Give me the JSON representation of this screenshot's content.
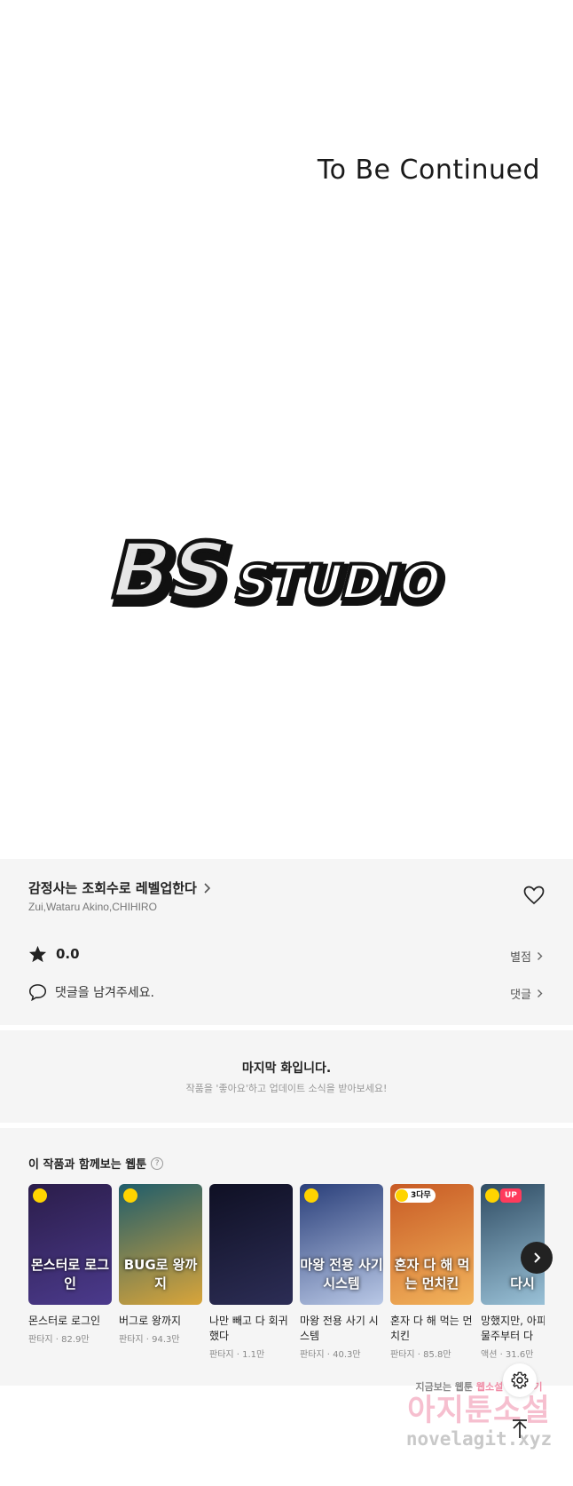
{
  "comic": {
    "to_be_continued": "To Be Continued",
    "logo_text_bs": "BS",
    "logo_text_studio": "STUDIO"
  },
  "info": {
    "title": "감정사는 조회수로 레벨업한다",
    "authors": "Zui,Wataru Akino,CHIHIRO",
    "rating": "0.0",
    "rate_link": "별점",
    "comment_prompt": "댓글을 남겨주세요.",
    "comment_link": "댓글"
  },
  "last_episode": {
    "title": "마지막 화입니다.",
    "subtitle": "작품을 '좋아요'하고 업데이트 소식을 받아보세요!"
  },
  "recommend": {
    "heading": "이 작품과 함께보는 웹툰",
    "help": "?",
    "items": [
      {
        "name": "몬스터로 로그인",
        "meta": "판타지 · 82.9만",
        "thumb_text": "몬스터로 로그인",
        "badge": "clock",
        "colors": [
          "#2b1d4a",
          "#4b3a8c"
        ]
      },
      {
        "name": "버그로 왕까지",
        "meta": "판타지 · 94.3만",
        "thumb_text": "BUG로 왕까지",
        "badge": "clock",
        "colors": [
          "#1f5d6b",
          "#d9a53a"
        ]
      },
      {
        "name": "나만 빼고 다 회귀했다",
        "meta": "판타지 · 1.1만",
        "thumb_text": "",
        "badge": "",
        "colors": [
          "#0f1024",
          "#2c2d55"
        ]
      },
      {
        "name": "마왕 전용 사기 시스템",
        "meta": "판타지 · 40.3만",
        "thumb_text": "마왕 전용 사기 시스템",
        "badge": "clock",
        "colors": [
          "#2a3f7a",
          "#b9c8e6"
        ]
      },
      {
        "name": "혼자 다 해 먹는 먼치킨",
        "meta": "판타지 · 85.8만",
        "thumb_text": "혼자 다 해 먹는 먼치킨",
        "badge": "3다무",
        "colors": [
          "#c85a24",
          "#f2b45c"
        ]
      },
      {
        "name": "망했지만, 아피 건물주부터 다",
        "meta": "액션 · 31.6만",
        "thumb_text": "다시",
        "badge": "UP",
        "colors": [
          "#2f4c63",
          "#9fc7dd"
        ]
      }
    ]
  },
  "watermark": {
    "line1_a": "지금보는",
    "line1_b": "웹툰",
    "line1_c": "웹소설 보러가기",
    "line2": "아지툰소설",
    "line3": "novelagit.xyz"
  },
  "colors": {
    "panel_bg": "#f5f5f5",
    "badge_yellow": "#ffd400",
    "badge_up": "#ff3b5c"
  }
}
